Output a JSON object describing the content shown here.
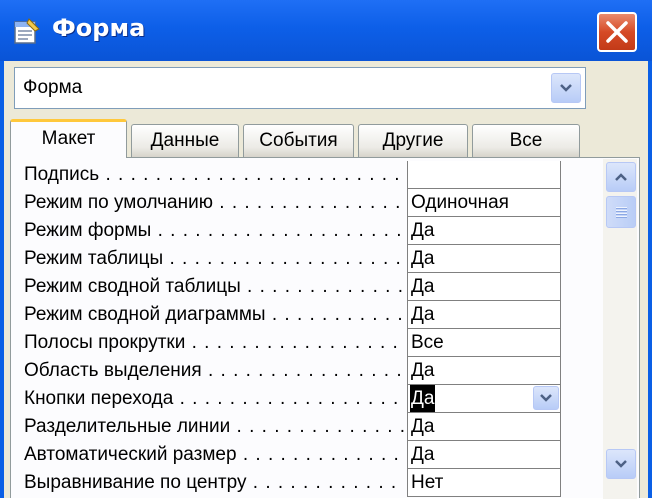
{
  "window": {
    "title": "Форма",
    "title_icon": "properties-form-icon",
    "close_icon": "close-icon",
    "colors": {
      "titlebar": "#0A5FE6",
      "close": "#D64A26",
      "tab_highlight": "#FFC83C",
      "client": "#ECE9D8"
    }
  },
  "object_selector": {
    "value": "Форма",
    "arrow_icon": "chevron-down-icon"
  },
  "tabs": [
    {
      "label": "Макет",
      "active": true
    },
    {
      "label": "Данные",
      "active": false
    },
    {
      "label": "События",
      "active": false
    },
    {
      "label": "Другие",
      "active": false
    },
    {
      "label": "Все",
      "active": false
    }
  ],
  "properties": [
    {
      "label": "Подпись",
      "value": ""
    },
    {
      "label": "Режим по умолчанию",
      "value": "Одиночная"
    },
    {
      "label": "Режим формы",
      "value": "Да"
    },
    {
      "label": "Режим таблицы",
      "value": "Да"
    },
    {
      "label": "Режим сводной таблицы",
      "value": "Да"
    },
    {
      "label": "Режим сводной диаграммы",
      "value": "Да"
    },
    {
      "label": "Полосы прокрутки",
      "value": "Все"
    },
    {
      "label": "Область выделения",
      "value": "Да"
    },
    {
      "label": "Кнопки перехода",
      "value": "Да",
      "selected": true
    },
    {
      "label": "Разделительные линии",
      "value": "Да"
    },
    {
      "label": "Автоматический размер",
      "value": "Да"
    },
    {
      "label": "Выравнивание по центру",
      "value": "Нет"
    }
  ],
  "scrollbar": {
    "up_icon": "scroll-up-icon",
    "down_icon": "scroll-down-icon",
    "thumb_icon": "scroll-thumb-grip-icon"
  }
}
